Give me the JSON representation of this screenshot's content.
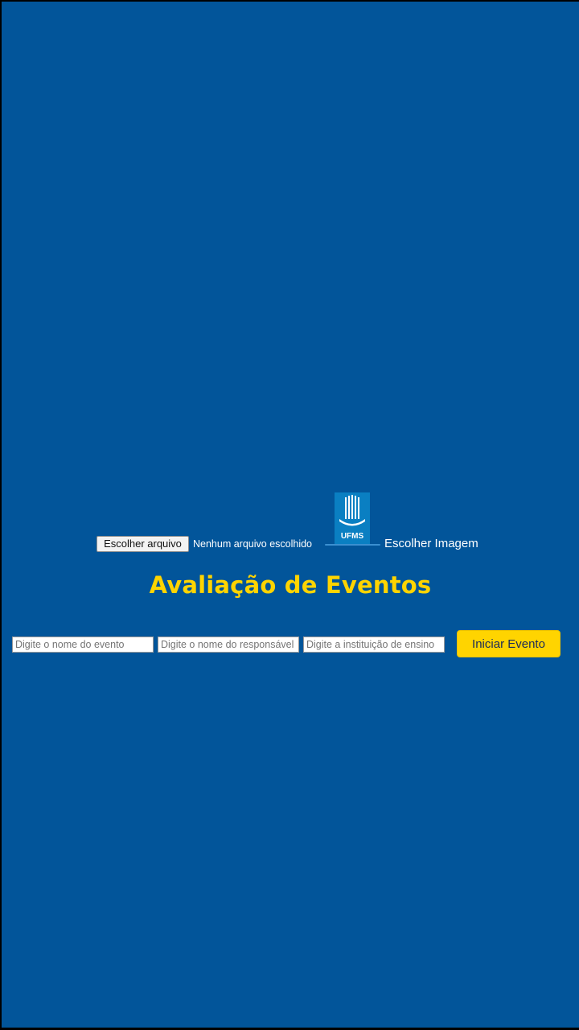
{
  "colors": {
    "page_background": "#02559A",
    "accent": "#FFD400",
    "logo_blue": "#0A7FC2"
  },
  "file_picker": {
    "button_label": "Escolher arquivo",
    "status_text": "Nenhum arquivo escolhido"
  },
  "logo": {
    "icon": "ufms-logo-icon",
    "text": "UFMS"
  },
  "choose_image_label": "Escolher Imagem",
  "title": "Avaliação de Eventos",
  "form": {
    "event_name_placeholder": "Digite o nome do evento",
    "event_name_value": "",
    "responsible_placeholder": "Digite o nome do responsável",
    "responsible_value": "",
    "institution_placeholder": "Digite a instituição de ensino",
    "institution_value": "",
    "start_button_label": "Iniciar Evento"
  }
}
